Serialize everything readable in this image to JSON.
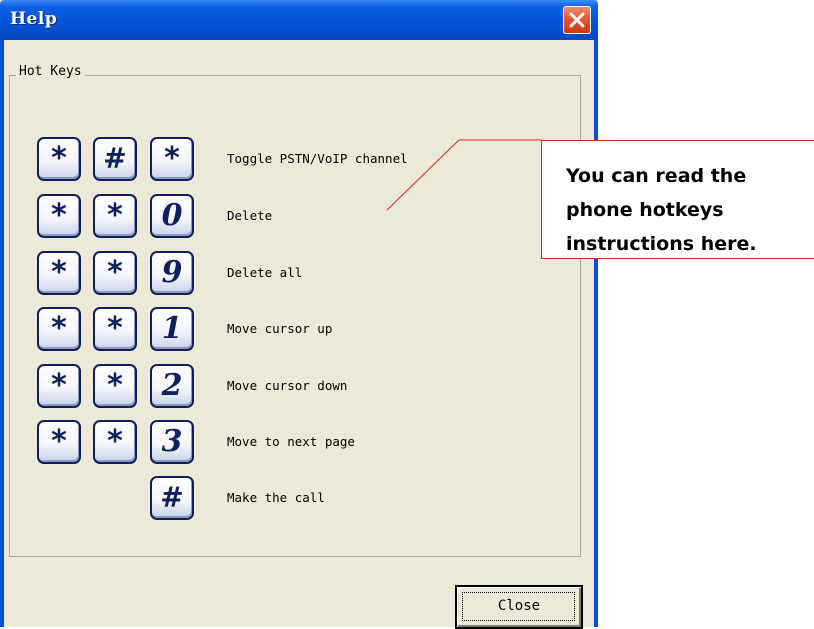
{
  "window": {
    "title": "Help",
    "close_icon": "close-x-icon"
  },
  "hotkeys_group": {
    "label": "Hot Keys",
    "rows": [
      {
        "keys": [
          "*",
          "#",
          "*"
        ],
        "description": "Toggle PSTN/VoIP channel"
      },
      {
        "keys": [
          "*",
          "*",
          "0"
        ],
        "description": "Delete"
      },
      {
        "keys": [
          "*",
          "*",
          "9"
        ],
        "description": "Delete all"
      },
      {
        "keys": [
          "*",
          "*",
          "1"
        ],
        "description": "Move cursor up"
      },
      {
        "keys": [
          "*",
          "*",
          "2"
        ],
        "description": "Move cursor down"
      },
      {
        "keys": [
          "*",
          "*",
          "3"
        ],
        "description": "Move to next page"
      },
      {
        "keys": [
          "#"
        ],
        "description": "Make the call"
      }
    ]
  },
  "footer": {
    "close_label": "Close"
  },
  "callout": {
    "lines": [
      "You can read the",
      "phone hotkeys",
      "instructions here."
    ],
    "border_color": "#e0221f"
  },
  "colors": {
    "titlebar": "#0452d4",
    "dialog_bg": "#ece9d8",
    "key_border": "#0f1f5c",
    "close_x": "#e2532f"
  }
}
